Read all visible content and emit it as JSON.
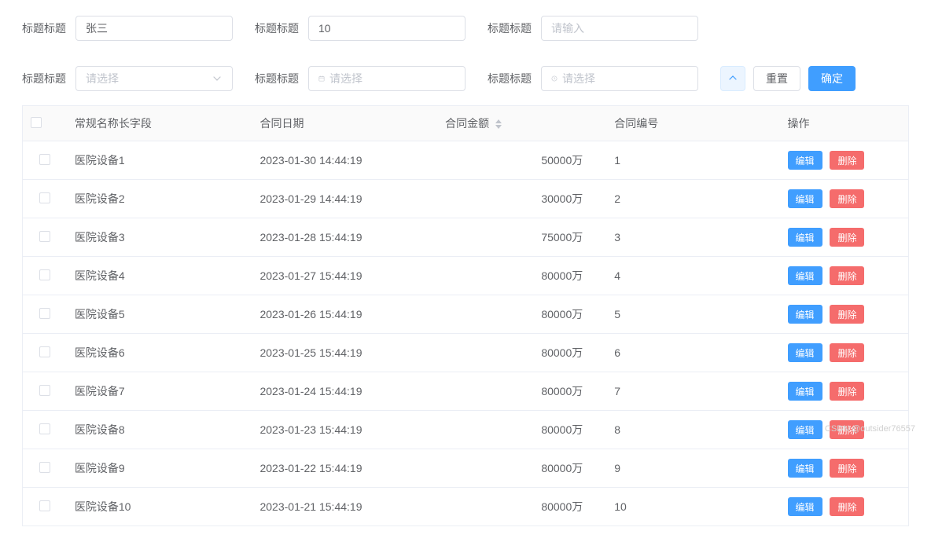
{
  "filters": {
    "row1": [
      {
        "label": "标题标题",
        "type": "input",
        "value": "张三",
        "placeholder": ""
      },
      {
        "label": "标题标题",
        "type": "input",
        "value": "10",
        "placeholder": ""
      },
      {
        "label": "标题标题",
        "type": "input",
        "value": "",
        "placeholder": "请输入"
      }
    ],
    "row2": [
      {
        "label": "标题标题",
        "type": "select",
        "value": "",
        "placeholder": "请选择"
      },
      {
        "label": "标题标题",
        "type": "date",
        "value": "",
        "placeholder": "请选择"
      },
      {
        "label": "标题标题",
        "type": "time",
        "value": "",
        "placeholder": "请选择"
      }
    ],
    "buttons": {
      "reset": "重置",
      "submit": "确定"
    }
  },
  "table": {
    "columns": {
      "name": "常规名称长字段",
      "date": "合同日期",
      "amount": "合同金额",
      "no": "合同编号",
      "ops": "操作"
    },
    "ops": {
      "edit": "编辑",
      "delete": "删除"
    },
    "rows": [
      {
        "name": "医院设备1",
        "date": "2023-01-30 14:44:19",
        "amount": "50000万",
        "no": "1"
      },
      {
        "name": "医院设备2",
        "date": "2023-01-29 14:44:19",
        "amount": "30000万",
        "no": "2"
      },
      {
        "name": "医院设备3",
        "date": "2023-01-28 15:44:19",
        "amount": "75000万",
        "no": "3"
      },
      {
        "name": "医院设备4",
        "date": "2023-01-27 15:44:19",
        "amount": "80000万",
        "no": "4"
      },
      {
        "name": "医院设备5",
        "date": "2023-01-26 15:44:19",
        "amount": "80000万",
        "no": "5"
      },
      {
        "name": "医院设备6",
        "date": "2023-01-25 15:44:19",
        "amount": "80000万",
        "no": "6"
      },
      {
        "name": "医院设备7",
        "date": "2023-01-24 15:44:19",
        "amount": "80000万",
        "no": "7"
      },
      {
        "name": "医院设备8",
        "date": "2023-01-23 15:44:19",
        "amount": "80000万",
        "no": "8"
      },
      {
        "name": "医院设备9",
        "date": "2023-01-22 15:44:19",
        "amount": "80000万",
        "no": "9"
      },
      {
        "name": "医院设备10",
        "date": "2023-01-21 15:44:19",
        "amount": "80000万",
        "no": "10"
      }
    ]
  },
  "watermark": "CSDN @outsider76557"
}
